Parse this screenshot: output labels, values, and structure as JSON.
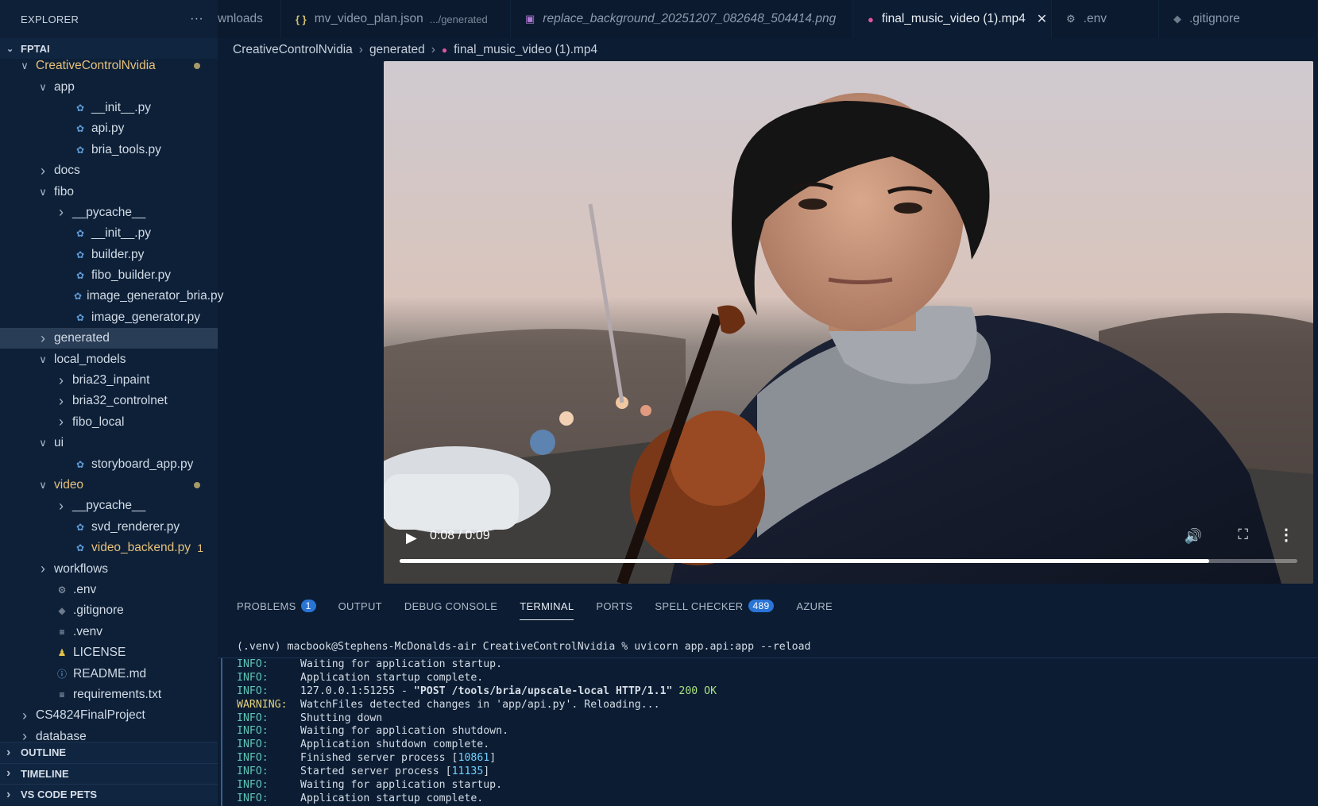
{
  "sidebar": {
    "title": "EXPLORER",
    "more": "···",
    "workspace": "FPTAI",
    "tree": [
      {
        "label": "CreativeControlNvidia",
        "indent": 1,
        "chev": "down",
        "modified": true,
        "dot": true
      },
      {
        "label": "app",
        "indent": 2,
        "chev": "down"
      },
      {
        "label": "__init__.py",
        "indent": 3,
        "icon": "py"
      },
      {
        "label": "api.py",
        "indent": 3,
        "icon": "py"
      },
      {
        "label": "bria_tools.py",
        "indent": 3,
        "icon": "py"
      },
      {
        "label": "docs",
        "indent": 2,
        "chev": "right"
      },
      {
        "label": "fibo",
        "indent": 2,
        "chev": "down"
      },
      {
        "label": "__pycache__",
        "indent": 3,
        "chev": "right"
      },
      {
        "label": "__init__.py",
        "indent": 3,
        "icon": "py"
      },
      {
        "label": "builder.py",
        "indent": 3,
        "icon": "py"
      },
      {
        "label": "fibo_builder.py",
        "indent": 3,
        "icon": "py"
      },
      {
        "label": "image_generator_bria.py",
        "indent": 3,
        "icon": "py"
      },
      {
        "label": "image_generator.py",
        "indent": 3,
        "icon": "py"
      },
      {
        "label": "generated",
        "indent": 2,
        "chev": "right",
        "selected": true
      },
      {
        "label": "local_models",
        "indent": 2,
        "chev": "down"
      },
      {
        "label": "bria23_inpaint",
        "indent": 3,
        "chev": "right"
      },
      {
        "label": "bria32_controlnet",
        "indent": 3,
        "chev": "right"
      },
      {
        "label": "fibo_local",
        "indent": 3,
        "chev": "right"
      },
      {
        "label": "ui",
        "indent": 2,
        "chev": "down"
      },
      {
        "label": "storyboard_app.py",
        "indent": 3,
        "icon": "py"
      },
      {
        "label": "video",
        "indent": 2,
        "chev": "down",
        "modified": true,
        "dot": true
      },
      {
        "label": "__pycache__",
        "indent": 3,
        "chev": "right"
      },
      {
        "label": "svd_renderer.py",
        "indent": 3,
        "icon": "py"
      },
      {
        "label": "video_backend.py",
        "indent": 3,
        "icon": "py",
        "modified": true,
        "count": "1"
      },
      {
        "label": "workflows",
        "indent": 2,
        "chev": "right"
      },
      {
        "label": ".env",
        "indent": 2,
        "icon": "gear"
      },
      {
        "label": ".gitignore",
        "indent": 2,
        "icon": "git"
      },
      {
        "label": ".venv",
        "indent": 2,
        "icon": "list"
      },
      {
        "label": "LICENSE",
        "indent": 2,
        "icon": "license"
      },
      {
        "label": "README.md",
        "indent": 2,
        "icon": "info"
      },
      {
        "label": "requirements.txt",
        "indent": 2,
        "icon": "list"
      },
      {
        "label": "CS4824FinalProject",
        "indent": 1,
        "chev": "right"
      },
      {
        "label": "database",
        "indent": 1,
        "chev": "right"
      }
    ],
    "sections": [
      "OUTLINE",
      "TIMELINE",
      "VS CODE PETS"
    ]
  },
  "tabs": [
    {
      "label": "wnloads",
      "icon": "",
      "sub": ""
    },
    {
      "label": "mv_video_plan.json",
      "icon": "json",
      "sub": ".../generated"
    },
    {
      "label": "replace_background_20251207_082648_504414.png",
      "icon": "png",
      "sub": "",
      "italic": true
    },
    {
      "label": "final_music_video (1).mp4",
      "icon": "mp4",
      "sub": "",
      "active": true,
      "close": "✕"
    },
    {
      "label": ".env",
      "icon": "gear",
      "sub": ""
    },
    {
      "label": ".gitignore",
      "icon": "git",
      "sub": ""
    }
  ],
  "breadcrumb": [
    "CreativeControlNvidia",
    "generated",
    "final_music_video (1).mp4"
  ],
  "video": {
    "time": "0:08 / 0:09",
    "progress": 0.902
  },
  "panel_tabs": [
    {
      "label": "PROBLEMS",
      "badge": "1"
    },
    {
      "label": "OUTPUT"
    },
    {
      "label": "DEBUG CONSOLE"
    },
    {
      "label": "TERMINAL",
      "active": true
    },
    {
      "label": "PORTS"
    },
    {
      "label": "SPELL CHECKER",
      "badge": "489"
    },
    {
      "label": "AZURE"
    }
  ],
  "terminal": {
    "prompt": "(.venv) macbook@Stephens-McDonalds-air CreativeControlNvidia % uvicorn app.api:app --reload",
    "lines": [
      {
        "level": "INFO:",
        "msg": "Waiting for application startup."
      },
      {
        "level": "INFO:",
        "msg": "Application startup complete."
      },
      {
        "level": "INFO:",
        "msg": "127.0.0.1:51255 - \"POST /tools/bria/upscale-local HTTP/1.1\" 200 OK"
      },
      {
        "level": "WARNING:",
        "msg": "WatchFiles detected changes in 'app/api.py'. Reloading..."
      },
      {
        "level": "INFO:",
        "msg": "Shutting down"
      },
      {
        "level": "INFO:",
        "msg": "Waiting for application shutdown."
      },
      {
        "level": "INFO:",
        "msg": "Application shutdown complete."
      },
      {
        "level": "INFO:",
        "msg": "Finished server process [10861]"
      },
      {
        "level": "INFO:",
        "msg": "Started server process [11135]"
      },
      {
        "level": "INFO:",
        "msg": "Waiting for application startup."
      },
      {
        "level": "INFO:",
        "msg": "Application startup complete."
      }
    ]
  }
}
